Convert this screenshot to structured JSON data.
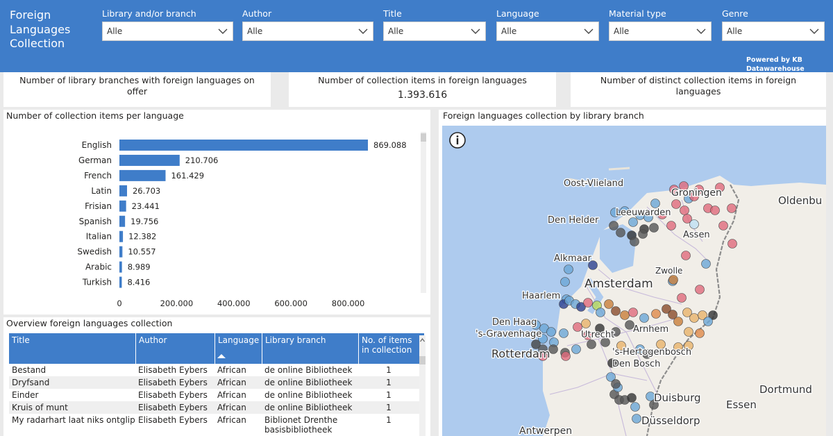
{
  "header": {
    "title": "Foreign Languages Collection",
    "powered_by": "Powered by KB Datawarehouse",
    "filters": [
      {
        "label": "Library and/or branch",
        "value": "Alle"
      },
      {
        "label": "Author",
        "value": "Alle"
      },
      {
        "label": "Title",
        "value": "Alle"
      },
      {
        "label": "Language",
        "value": "Alle"
      },
      {
        "label": "Material type",
        "value": "Alle"
      },
      {
        "label": "Genre",
        "value": "Alle"
      }
    ]
  },
  "kpis": [
    {
      "label": "Number of library branches with foreign languages on offer",
      "value": ""
    },
    {
      "label": "Number of collection items in foreign languages",
      "value": "1.393.616"
    },
    {
      "label": "Number of distinct collection items in foreign languages",
      "value": ""
    }
  ],
  "bar_panel": {
    "title": "Number of collection items per language"
  },
  "chart_data": {
    "type": "bar",
    "orientation": "horizontal",
    "categories": [
      "English",
      "German",
      "French",
      "Latin",
      "Frisian",
      "Spanish",
      "Italian",
      "Swedish",
      "Arabic",
      "Turkish"
    ],
    "values": [
      869088,
      210706,
      161429,
      26703,
      23441,
      19756,
      12382,
      10557,
      8989,
      8416
    ],
    "value_labels": [
      "869.088",
      "210.706",
      "161.429",
      "26.703",
      "23.441",
      "19.756",
      "12.382",
      "10.557",
      "8.989",
      "8.416"
    ],
    "xticks": [
      "0",
      "200.000",
      "400.000",
      "600.000",
      "800.000"
    ],
    "xtick_values": [
      0,
      200000,
      400000,
      600000,
      800000
    ],
    "xlim": [
      0,
      1000000
    ],
    "bar_color": "#3f7dc9",
    "grid": false
  },
  "table_panel": {
    "title": "Overview foreign languages collection",
    "columns": [
      "Title",
      "Author",
      "Language",
      "Library branch",
      "No. of items in collection"
    ],
    "rows": [
      {
        "title": "Bestand",
        "author": "Elisabeth Eybers",
        "language": "African",
        "branch": "de online Bibliotheek",
        "items": "1"
      },
      {
        "title": "Dryfsand",
        "author": "Elisabeth Eybers",
        "language": "African",
        "branch": "de online Bibliotheek",
        "items": "1"
      },
      {
        "title": "Einder",
        "author": "Elisabeth Eybers",
        "language": "African",
        "branch": "de online Bibliotheek",
        "items": "1"
      },
      {
        "title": "Kruis of munt",
        "author": "Elisabeth Eybers",
        "language": "African",
        "branch": "de online Bibliotheek",
        "items": "1"
      },
      {
        "title": "My radarhart laat niks ontglip",
        "author": "Elisabeth Eybers",
        "language": "African",
        "branch": "Biblionet Drenthe basisbibliotheek",
        "items": "1"
      }
    ]
  },
  "map_panel": {
    "title": "Foreign languages collection by library branch",
    "info_icon": "info-icon",
    "places": [
      {
        "name": "Oost-Vlieland",
        "size": 13
      },
      {
        "name": "Groningen",
        "size": 14
      },
      {
        "name": "Oldenbu",
        "size": 15
      },
      {
        "name": "Leeuwarden",
        "size": 13
      },
      {
        "name": "Den Helder",
        "size": 13
      },
      {
        "name": "Assen",
        "size": 13
      },
      {
        "name": "Alkmaar",
        "size": 13
      },
      {
        "name": "Amsterdam",
        "size": 17
      },
      {
        "name": "Haarlem",
        "size": 13
      },
      {
        "name": "Den Haag",
        "size": 13
      },
      {
        "name": "'s-Gravenhage",
        "size": 13
      },
      {
        "name": "Utrecht",
        "size": 13
      },
      {
        "name": "Arnhem",
        "size": 13
      },
      {
        "name": "Rotterdam",
        "size": 16
      },
      {
        "name": "'s-Hertogenbosch",
        "size": 13
      },
      {
        "name": "Den Bosch",
        "size": 13
      },
      {
        "name": "Duisburg",
        "size": 15
      },
      {
        "name": "Dortmund",
        "size": 15
      },
      {
        "name": "Essen",
        "size": 15
      },
      {
        "name": "Düsseldorp",
        "size": 15
      },
      {
        "name": "Antwerpen",
        "size": 14
      },
      {
        "name": "Zwolle",
        "size": 12
      }
    ],
    "land_color": "#f1eee8",
    "water_color": "#aecbee"
  }
}
